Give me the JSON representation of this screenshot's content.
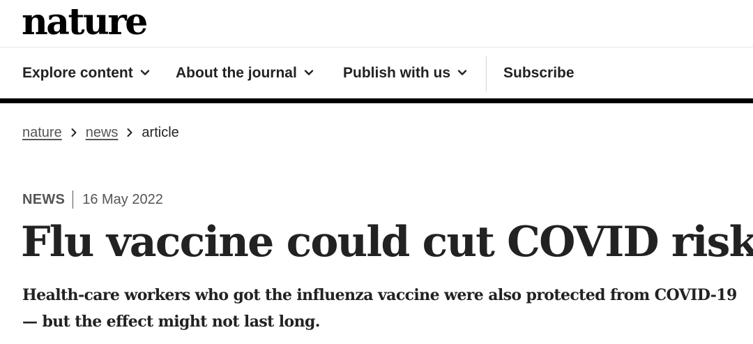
{
  "header": {
    "logo": "nature"
  },
  "nav": {
    "items": [
      {
        "label": "Explore content",
        "has_dropdown": true
      },
      {
        "label": "About the journal",
        "has_dropdown": true
      },
      {
        "label": "Publish with us",
        "has_dropdown": true
      },
      {
        "label": "Subscribe",
        "has_dropdown": false
      }
    ]
  },
  "breadcrumb": {
    "items": [
      {
        "label": "nature",
        "link": true
      },
      {
        "label": "news",
        "link": true
      },
      {
        "label": "article",
        "link": false
      }
    ]
  },
  "article": {
    "type": "NEWS",
    "date": "16 May 2022",
    "title": "Flu vaccine could cut COVID risk",
    "standfirst": "Health-care workers who got the influenza vaccine were also protected from COVID-19 — but the effect might not last long."
  },
  "icons": {
    "dropdown": "chevron-down-icon",
    "breadcrumb_separator": "chevron-right-icon"
  },
  "colors": {
    "text": "#222222",
    "muted": "#555555",
    "rule": "#000000"
  }
}
